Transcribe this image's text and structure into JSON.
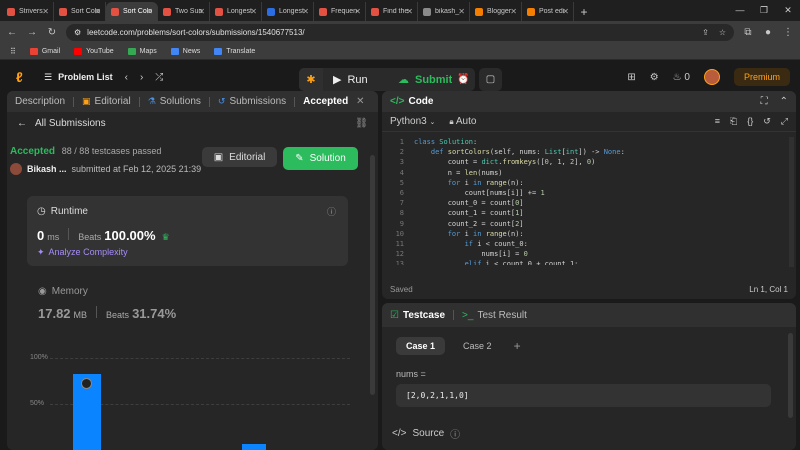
{
  "browser": {
    "tabs": [
      {
        "label": "Strivers",
        "color": "#e25141"
      },
      {
        "label": "Sort Colo",
        "color": "#e25141"
      },
      {
        "label": "Sort Colo",
        "color": "#e25141"
      },
      {
        "label": "Two Sun",
        "color": "#e25141"
      },
      {
        "label": "Longest",
        "color": "#e25141"
      },
      {
        "label": "Longest",
        "color": "#2b6de3"
      },
      {
        "label": "Frequen",
        "color": "#e25141"
      },
      {
        "label": "Find the",
        "color": "#e25141"
      },
      {
        "label": "bikash_",
        "color": "#8a8a8a"
      },
      {
        "label": "Blogger",
        "color": "#f57d00"
      },
      {
        "label": "Post edi",
        "color": "#f57d00"
      }
    ],
    "url": "leetcode.com/problems/sort-colors/submissions/1540677513/",
    "bookmarks": [
      {
        "label": "Gmail",
        "color": "#ea4335"
      },
      {
        "label": "YouTube",
        "color": "#ff0000"
      },
      {
        "label": "Maps",
        "color": "#34a853"
      },
      {
        "label": "News",
        "color": "#4285f4"
      },
      {
        "label": "Translate",
        "color": "#4285f4"
      }
    ]
  },
  "header": {
    "problem_list": "Problem List",
    "run": "Run",
    "submit": "Submit",
    "streak": "0",
    "premium": "Premium"
  },
  "left": {
    "tabs": [
      "Description",
      "Editorial",
      "Solutions",
      "Submissions",
      "Accepted"
    ],
    "all_submissions": "All Submissions",
    "status": "Accepted",
    "passed": "88 / 88 testcases passed",
    "user": "Bikash ...",
    "submitted": "submitted at Feb 12, 2025 21:39",
    "editorial_btn": "Editorial",
    "solution_btn": "Solution",
    "runtime": {
      "label": "Runtime",
      "value": "0",
      "unit": "ms",
      "beats_label": "Beats",
      "beats": "100.00%",
      "analyze": "Analyze Complexity"
    },
    "memory": {
      "label": "Memory",
      "value": "17.82",
      "unit": "MB",
      "beats_label": "Beats",
      "beats": "31.74%"
    },
    "chart": {
      "yticks": [
        "100%",
        "50%"
      ]
    }
  },
  "code": {
    "title": "Code",
    "language": "Python3",
    "auto": "Auto",
    "saved": "Saved",
    "position": "Ln 1, Col 1",
    "line_numbers": [
      "1",
      "2",
      "3",
      "4",
      "5",
      "6",
      "7",
      "8",
      "9",
      "10",
      "11",
      "12",
      "13"
    ],
    "lines": [
      "class Solution:",
      "    def sortColors(self, nums: List[int]) -> None:",
      "        count = dict.fromkeys([0, 1, 2], 0)",
      "        n = len(nums)",
      "        for i in range(n):",
      "            count[nums[i]] += 1",
      "        count_0 = count[0]",
      "        count_1 = count[1]",
      "        count_2 = count[2]",
      "        for i in range(n):",
      "            if i < count_0:",
      "                nums[i] = 0",
      "            elif i < count_0 + count_1:"
    ]
  },
  "test": {
    "testcase_tab": "Testcase",
    "result_tab": "Test Result",
    "cases": [
      "Case 1",
      "Case 2"
    ],
    "var_name": "nums =",
    "var_value": "[2,0,2,1,1,0]",
    "source": "Source"
  },
  "colors": {
    "accent": "#ffa116",
    "green": "#2cbb5d",
    "blue": "#0a84ff"
  }
}
